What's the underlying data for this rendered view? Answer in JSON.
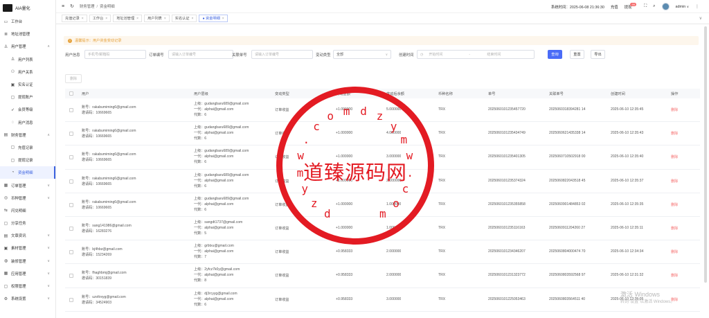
{
  "brand": {
    "name": "AIA量化"
  },
  "sidebar": {
    "items": [
      {
        "label": "工作台",
        "icon": "monitor-icon",
        "type": "top"
      },
      {
        "label": "地址池管理",
        "icon": "list-icon",
        "type": "top"
      },
      {
        "label": "用户管理",
        "icon": "user-icon",
        "type": "group",
        "expanded": true
      },
      {
        "label": "用户列表",
        "icon": "user-icon",
        "type": "sub"
      },
      {
        "label": "用户关系",
        "icon": "users-icon",
        "type": "sub"
      },
      {
        "label": "实名认证",
        "icon": "id-card-icon",
        "type": "sub"
      },
      {
        "label": "提现账户",
        "icon": "folder-icon",
        "type": "sub"
      },
      {
        "label": "会员等级",
        "icon": "rocket-icon",
        "type": "sub"
      },
      {
        "label": "用户消息",
        "icon": "chat-icon",
        "type": "sub"
      },
      {
        "label": "财务管理",
        "icon": "wallet-icon",
        "type": "group",
        "expanded": true
      },
      {
        "label": "充值记录",
        "icon": "folder-icon",
        "type": "sub"
      },
      {
        "label": "提现记录",
        "icon": "folder-icon",
        "type": "sub"
      },
      {
        "label": "资金明细",
        "icon": "pie-icon",
        "type": "sub",
        "active": true
      },
      {
        "label": "订单管理",
        "icon": "order-icon",
        "type": "group"
      },
      {
        "label": "币种管理",
        "icon": "coin-icon",
        "type": "group"
      },
      {
        "label": "闪兑明细",
        "icon": "exchange-icon",
        "type": "top"
      },
      {
        "label": "分享任务",
        "icon": "share-icon",
        "type": "top"
      },
      {
        "label": "文章资讯",
        "icon": "article-icon",
        "type": "group"
      },
      {
        "label": "素材管理",
        "icon": "image-icon",
        "type": "group"
      },
      {
        "label": "装修管理",
        "icon": "palette-icon",
        "type": "group"
      },
      {
        "label": "应用管理",
        "icon": "app-icon",
        "type": "group"
      },
      {
        "label": "权限管理",
        "icon": "lock-icon",
        "type": "group"
      },
      {
        "label": "系统设置",
        "icon": "gear-icon",
        "type": "group"
      }
    ]
  },
  "topbar": {
    "breadcrumb": [
      "财务管理",
      "资金明细"
    ],
    "sep": "/",
    "system_time": "系统时间：2025-06-08 21:36:30",
    "recharge": "充值",
    "withdraw": "提现",
    "withdraw_badge": "99",
    "username": "admin"
  },
  "tabs": [
    {
      "label": "充值记录",
      "active": false
    },
    {
      "label": "工作台",
      "active": false
    },
    {
      "label": "地址池管理",
      "active": false
    },
    {
      "label": "用户列表",
      "active": false
    },
    {
      "label": "实名认证",
      "active": false
    },
    {
      "label": "● 资金明细",
      "active": true
    }
  ],
  "notice": {
    "text": "温馨提示：用户资金变动记录"
  },
  "filters": {
    "user_label": "用户信息",
    "user_placeholder": "手机号/邮箱码",
    "order_label": "订单编号",
    "order_placeholder": "请输入订单编号",
    "related_label": "关联单号",
    "related_placeholder": "请输入订单编号",
    "type_label": "变动类型",
    "type_value": "全部",
    "time_label": "创建时间",
    "start_placeholder": "开始时间",
    "range_sep": "-",
    "end_placeholder": "结束时间",
    "search": "查询",
    "reset": "重置",
    "export": "导出"
  },
  "actions": {
    "delete": "删除"
  },
  "table": {
    "headers": [
      "用户",
      "用户层级",
      "变动类型",
      "变动金额",
      "变动后余额",
      "币种名称",
      "单号",
      "关联单号",
      "创建时间",
      "操作"
    ],
    "rows": [
      {
        "account": "账号：rakabumiming6@gmail.com",
        "invite": "邀请码：10669665",
        "up": "上级：gudangbaru689@gmail.com",
        "gen1": "一代：alphai@gmail.com",
        "gen": "代数：6",
        "type": "订单收益",
        "amount": "+1.000000",
        "balance": "5.000000",
        "coin": "TRX",
        "no": "2025060101235457720",
        "rel": "2025060318394281 14",
        "time": "2025-06-10 12:35:45",
        "op": "删除"
      },
      {
        "account": "账号：rakabumiming6@gmail.com",
        "invite": "邀请码：10669665",
        "up": "上级：gudangbaru689@gmail.com",
        "gen1": "一代：alphai@gmail.com",
        "gen": "代数：6",
        "type": "订单收益",
        "amount": "+1.000000",
        "balance": "4.000000",
        "coin": "TRX",
        "no": "2025060101235434749",
        "rel": "2025060621435338 14",
        "time": "2025-06-10 12:35:43",
        "op": "删除"
      },
      {
        "account": "账号：rakabumiming6@gmail.com",
        "invite": "邀请码：10669665",
        "up": "上级：gudangbaru689@gmail.com",
        "gen1": "一代：alphai@gmail.com",
        "gen": "代数：6",
        "type": "订单收益",
        "amount": "+1.000000",
        "balance": "3.000000",
        "coin": "TRX",
        "no": "2025060101235401305",
        "rel": "2025060710502918 00",
        "time": "2025-06-10 12:35:40",
        "op": "删除"
      },
      {
        "account": "账号：rakabumiming6@gmail.com",
        "invite": "邀请码：10669665",
        "up": "上级：gudangbaru689@gmail.com",
        "gen1": "一代：alphai@gmail.com",
        "gen": "代数：6",
        "type": "订单收益",
        "amount": "+1.000000",
        "balance": "2.000000",
        "coin": "TRX",
        "no": "2025060101235374324",
        "rel": "2025060822043518 45",
        "time": "2025-06-10 12:35:37",
        "op": "删除"
      },
      {
        "account": "账号：rakabumiming6@gmail.com",
        "invite": "邀请码：10669665",
        "up": "上级：gudangbaru689@gmail.com",
        "gen1": "一代：alphai@gmail.com",
        "gen": "代数：6",
        "type": "订单收益",
        "amount": "+1.000000",
        "balance": "1.000000",
        "coin": "TRX",
        "no": "2025060101235355858",
        "rel": "2025060901484853 02",
        "time": "2025-06-10 12:35:35",
        "op": "删除"
      },
      {
        "account": "账号：sang141986@gmail.com",
        "invite": "邀请码：16283276",
        "up": "上级：sangdt1737@gmail.com",
        "gen1": "一代：alphai@gmail.com",
        "gen": "代数：5",
        "type": "订单收益",
        "amount": "+1.000000",
        "balance": "1.000000",
        "coin": "TRX",
        "no": "2025060101235116163",
        "rel": "2025060911204260 27",
        "time": "2025-06-10 12:35:11",
        "op": "删除"
      },
      {
        "account": "账号：bj4hbz@gmail.com",
        "invite": "邀请码：15234269",
        "up": "上级：grbtxu@gmail.com",
        "gen1": "一代：alphai@gmail.com",
        "gen": "代数：7",
        "type": "订单收益",
        "amount": "+0.958333",
        "balance": "2.000000",
        "coin": "TRX",
        "no": "2025060101234346207",
        "rel": "2025060804000474 70",
        "time": "2025-06-10 12:34:34",
        "op": "删除"
      },
      {
        "account": "账号：fhaghbmj@gmail.com",
        "invite": "邀请码：30151839",
        "up": "上级：2yfcz7k0y@gmail.com",
        "gen1": "一代：alphai@gmail.com",
        "gen": "代数：8",
        "type": "订单收益",
        "amount": "+0.958333",
        "balance": "2.000000",
        "coin": "TRX",
        "no": "2025060101231323772",
        "rel": "2025060803592568 97",
        "time": "2025-06-10 12:31:32",
        "op": "删除"
      },
      {
        "account": "账号：uzvltrxyg@gmail.com",
        "invite": "邀请码：34524903",
        "up": "上级：dj3rcyyg@gmail.com",
        "gen1": "一代：alphai@gmail.com",
        "gen": "代数：6",
        "type": "订单收益",
        "amount": "+0.958333",
        "balance": "3.000000",
        "coin": "TRX",
        "no": "2025060101225053463",
        "rel": "2025060803564511 40",
        "time": "2025-06-10 12:25:05",
        "op": "删除"
      }
    ]
  },
  "watermark": {
    "text": "道臻源码网",
    "ring_chars": "dzymw.comdzymw.com"
  },
  "windows_watermark": {
    "line1": "激活 Windows",
    "line2": "转到\"设置\"以激活 Windows。"
  },
  "colors": {
    "primary": "#4a6cf7",
    "danger": "#f56c6c",
    "warning": "#e6a23c",
    "stamp": "#e31b23"
  }
}
